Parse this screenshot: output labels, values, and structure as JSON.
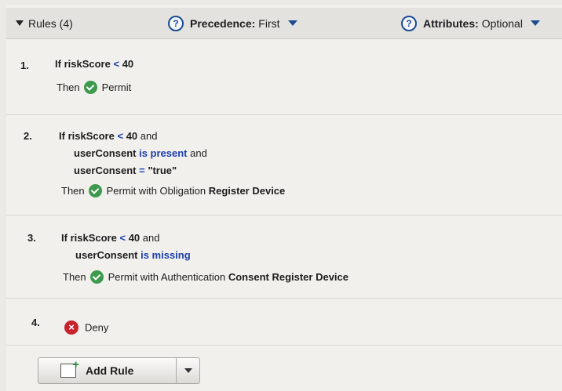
{
  "header": {
    "rules_label": "Rules (4)",
    "precedence_label": "Precedence:",
    "precedence_value": "First",
    "attributes_label": "Attributes:",
    "attributes_value": "Optional",
    "help_glyph": "?"
  },
  "rules": [
    {
      "number": "1.",
      "if": "If",
      "attr": "riskScore",
      "op": "<",
      "value": "40",
      "then": "Then",
      "result": "Permit"
    },
    {
      "number": "2.",
      "if": "If",
      "attr": "riskScore",
      "op": "<",
      "value": "40",
      "and1": "and",
      "attr2": "userConsent",
      "cond2": "is present",
      "and2": "and",
      "attr3": "userConsent",
      "op3": "=",
      "value3": "\"true\"",
      "then": "Then",
      "result": "Permit with Obligation",
      "result_bold": "Register Device"
    },
    {
      "number": "3.",
      "if": "If",
      "attr": "riskScore",
      "op": "<",
      "value": "40",
      "and1": "and",
      "attr2": "userConsent",
      "cond2": "is missing",
      "then": "Then",
      "result": "Permit with Authentication",
      "result_bold": "Consent Register Device"
    },
    {
      "number": "4.",
      "result": "Deny"
    }
  ],
  "add_rule": {
    "label": "Add Rule"
  },
  "icons": [
    "expand-triangle-icon",
    "help-icon",
    "dropdown-caret-icon",
    "permit-check-icon",
    "deny-x-icon",
    "add-rule-icon"
  ]
}
